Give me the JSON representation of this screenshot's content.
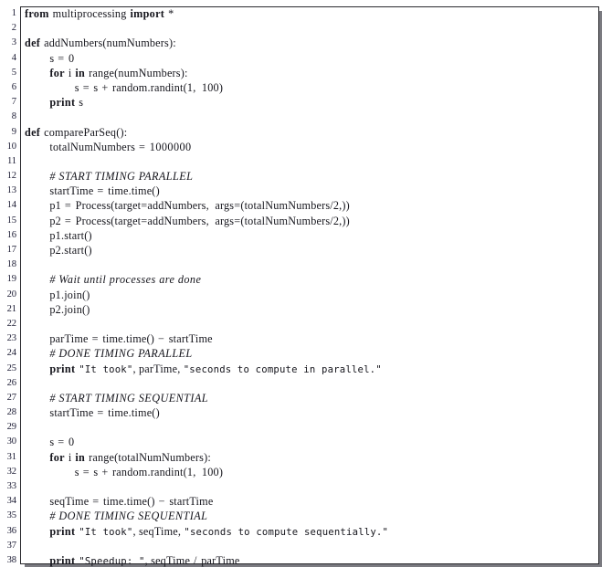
{
  "listing": {
    "language": "Python",
    "frame": "shadowbox",
    "first_line_number": 1,
    "last_line_number": 38,
    "text_color": "#15151c",
    "number_color": "#1b1b33",
    "background_color": "#ffffff",
    "border_color": "#2a2a2e",
    "shadow_color": "#7a7a80",
    "lines": [
      {
        "n": "1",
        "code": "from multiprocessing import *"
      },
      {
        "n": "2",
        "code": ""
      },
      {
        "n": "3",
        "code": "def addNumbers(numNumbers):"
      },
      {
        "n": "4",
        "code": "    s = 0"
      },
      {
        "n": "5",
        "code": "    for i in range(numNumbers):"
      },
      {
        "n": "6",
        "code": "        s = s + random.randint(1, 100)"
      },
      {
        "n": "7",
        "code": "    print s"
      },
      {
        "n": "8",
        "code": ""
      },
      {
        "n": "9",
        "code": "def compareParSeq():"
      },
      {
        "n": "10",
        "code": "    totalNumNumbers = 1000000"
      },
      {
        "n": "11",
        "code": ""
      },
      {
        "n": "12",
        "code": "    # START TIMING PARALLEL"
      },
      {
        "n": "13",
        "code": "    startTime = time.time()"
      },
      {
        "n": "14",
        "code": "    p1 = Process(target=addNumbers, args=(totalNumNumbers/2,))"
      },
      {
        "n": "15",
        "code": "    p2 = Process(target=addNumbers, args=(totalNumNumbers/2,))"
      },
      {
        "n": "16",
        "code": "    p1.start()"
      },
      {
        "n": "17",
        "code": "    p2.start()"
      },
      {
        "n": "18",
        "code": ""
      },
      {
        "n": "19",
        "code": "    # Wait until processes are done"
      },
      {
        "n": "20",
        "code": "    p1.join()"
      },
      {
        "n": "21",
        "code": "    p2.join()"
      },
      {
        "n": "22",
        "code": ""
      },
      {
        "n": "23",
        "code": "    parTime = time.time() - startTime"
      },
      {
        "n": "24",
        "code": "    # DONE TIMING PARALLEL"
      },
      {
        "n": "25",
        "code": "    print \"It took\", parTime, \"seconds to compute in parallel.\""
      },
      {
        "n": "26",
        "code": ""
      },
      {
        "n": "27",
        "code": "    # START TIMING SEQUENTIAL"
      },
      {
        "n": "28",
        "code": "    startTime = time.time()"
      },
      {
        "n": "29",
        "code": ""
      },
      {
        "n": "30",
        "code": "    s = 0"
      },
      {
        "n": "31",
        "code": "    for i in range(totalNumNumbers):"
      },
      {
        "n": "32",
        "code": "        s = s + random.randint(1, 100)"
      },
      {
        "n": "33",
        "code": ""
      },
      {
        "n": "34",
        "code": "    seqTime = time.time() - startTime"
      },
      {
        "n": "35",
        "code": "    # DONE TIMING SEQUENTIAL"
      },
      {
        "n": "36",
        "code": "    print \"It took\", seqTime, \"seconds to compute sequentially.\""
      },
      {
        "n": "37",
        "code": ""
      },
      {
        "n": "38",
        "code": "    print \"Speedup: \", seqTime / parTime"
      }
    ],
    "tokens": {
      "l1": [
        [
          "kw",
          "from"
        ],
        [
          "sp",
          " "
        ],
        [
          "id",
          "multiprocessing"
        ],
        [
          "sp",
          " "
        ],
        [
          "kw",
          "import"
        ],
        [
          "sp",
          " "
        ],
        [
          "op",
          "*"
        ]
      ],
      "l3": [
        [
          "kw",
          "def"
        ],
        [
          "sp",
          " "
        ],
        [
          "id",
          "addNumbers(numNumbers):"
        ]
      ],
      "l4": [
        [
          "id",
          "s"
        ],
        [
          "op",
          " = "
        ],
        [
          "num",
          "0"
        ]
      ],
      "l5": [
        [
          "kw",
          "for"
        ],
        [
          "sp",
          " "
        ],
        [
          "id",
          "i"
        ],
        [
          "sp",
          " "
        ],
        [
          "kw",
          "in"
        ],
        [
          "sp",
          " "
        ],
        [
          "id",
          "range(numNumbers):"
        ]
      ],
      "l6": [
        [
          "id",
          "s"
        ],
        [
          "op",
          " = "
        ],
        [
          "id",
          "s"
        ],
        [
          "op",
          " + "
        ],
        [
          "id",
          "random.randint(1,  100)"
        ]
      ],
      "l7": [
        [
          "kw",
          "print"
        ],
        [
          "sp",
          " "
        ],
        [
          "id",
          "s"
        ]
      ],
      "l9": [
        [
          "kw",
          "def"
        ],
        [
          "sp",
          " "
        ],
        [
          "id",
          "compareParSeq():"
        ]
      ],
      "l10": [
        [
          "id",
          "totalNumNumbers"
        ],
        [
          "op",
          " = "
        ],
        [
          "num",
          "1000000"
        ]
      ],
      "l12": [
        [
          "cmt",
          "# START TIMING PARALLEL"
        ]
      ],
      "l13": [
        [
          "id",
          "startTime"
        ],
        [
          "op",
          " = "
        ],
        [
          "id",
          "time.time()"
        ]
      ],
      "l14": [
        [
          "id",
          "p1"
        ],
        [
          "op",
          " = "
        ],
        [
          "id",
          "Process(target=addNumbers,  args=(totalNumNumbers/2,))"
        ]
      ],
      "l15": [
        [
          "id",
          "p2"
        ],
        [
          "op",
          " = "
        ],
        [
          "id",
          "Process(target=addNumbers,  args=(totalNumNumbers/2,))"
        ]
      ],
      "l16": [
        [
          "id",
          "p1.start()"
        ]
      ],
      "l17": [
        [
          "id",
          "p2.start()"
        ]
      ],
      "l19": [
        [
          "cmt",
          "# Wait until processes are done"
        ]
      ],
      "l20": [
        [
          "id",
          "p1.join()"
        ]
      ],
      "l21": [
        [
          "id",
          "p2.join()"
        ]
      ],
      "l23": [
        [
          "id",
          "parTime"
        ],
        [
          "op",
          " = "
        ],
        [
          "id",
          "time.time()"
        ],
        [
          "op",
          " − "
        ],
        [
          "id",
          "startTime"
        ]
      ],
      "l24": [
        [
          "cmt",
          "# DONE TIMING PARALLEL"
        ]
      ],
      "l25": [
        [
          "kw",
          "print"
        ],
        [
          "sp",
          " "
        ],
        [
          "str",
          "\"It took\""
        ],
        [
          "id",
          ", "
        ],
        [
          "id",
          "parTime"
        ],
        [
          "id",
          ", "
        ],
        [
          "str",
          "\"seconds to compute in parallel.\""
        ]
      ],
      "l27": [
        [
          "cmt",
          "# START TIMING SEQUENTIAL"
        ]
      ],
      "l28": [
        [
          "id",
          "startTime"
        ],
        [
          "op",
          " = "
        ],
        [
          "id",
          "time.time()"
        ]
      ],
      "l30": [
        [
          "id",
          "s"
        ],
        [
          "op",
          " = "
        ],
        [
          "num",
          "0"
        ]
      ],
      "l31": [
        [
          "kw",
          "for"
        ],
        [
          "sp",
          " "
        ],
        [
          "id",
          "i"
        ],
        [
          "sp",
          " "
        ],
        [
          "kw",
          "in"
        ],
        [
          "sp",
          " "
        ],
        [
          "id",
          "range(totalNumNumbers):"
        ]
      ],
      "l32": [
        [
          "id",
          "s"
        ],
        [
          "op",
          " = "
        ],
        [
          "id",
          "s"
        ],
        [
          "op",
          " + "
        ],
        [
          "id",
          "random.randint(1,  100)"
        ]
      ],
      "l34": [
        [
          "id",
          "seqTime"
        ],
        [
          "op",
          " = "
        ],
        [
          "id",
          "time.time()"
        ],
        [
          "op",
          " − "
        ],
        [
          "id",
          "startTime"
        ]
      ],
      "l35": [
        [
          "cmt",
          "# DONE TIMING SEQUENTIAL"
        ]
      ],
      "l36": [
        [
          "kw",
          "print"
        ],
        [
          "sp",
          " "
        ],
        [
          "str",
          "\"It took\""
        ],
        [
          "id",
          ", "
        ],
        [
          "id",
          "seqTime"
        ],
        [
          "id",
          ", "
        ],
        [
          "str",
          "\"seconds to compute sequentially.\""
        ]
      ],
      "l38": [
        [
          "kw",
          "print"
        ],
        [
          "sp",
          " "
        ],
        [
          "str",
          "\"Speedup: \""
        ],
        [
          "id",
          ", "
        ],
        [
          "id",
          "seqTime"
        ],
        [
          "op",
          " / "
        ],
        [
          "id",
          "parTime"
        ]
      ]
    }
  }
}
